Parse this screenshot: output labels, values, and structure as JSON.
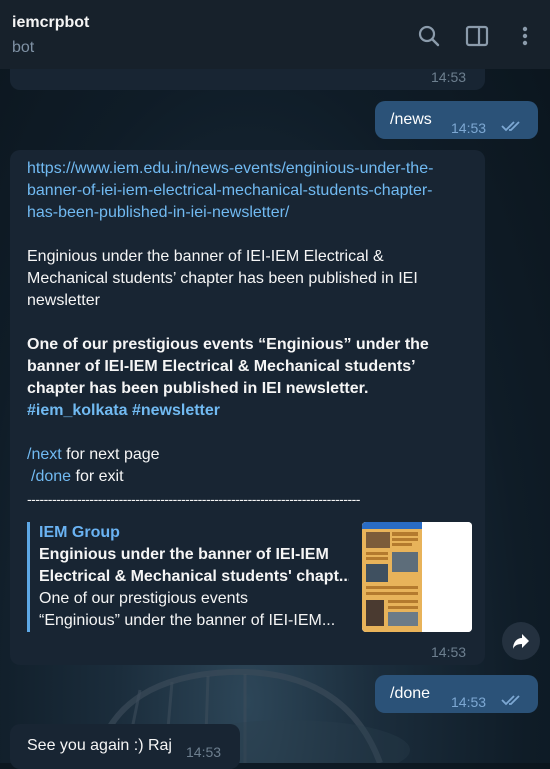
{
  "header": {
    "title": "iemcrpbot",
    "subtitle": "bot",
    "icons": [
      "search-icon",
      "sidebar-toggle-icon",
      "more-vertical-icon"
    ]
  },
  "messages": {
    "cutoff_time": "14:53",
    "news_cmd": {
      "text": "/news",
      "time": "14:53",
      "status": "read"
    },
    "article": {
      "url": "https://www.iem.edu.in/news-events/enginious-under-the-banner-of-iei-iem-electrical-mechanical-students-chapter-has-been-published-in-iei-newsletter/",
      "url_lines": [
        "https://www.iem.edu.in/news-events/enginious-under-the-",
        "banner-of-iei-iem-electrical-mechanical-students-chapter-",
        "has-been-published-in-iei-newsletter/"
      ],
      "title_lines": [
        "Enginious under the banner of IEI-IEM Electrical &",
        "Mechanical students’ chapter has been published in IEI",
        "newsletter"
      ],
      "bold_lines": [
        "One of our prestigious events “Enginious” under the",
        "banner of IEI-IEM Electrical & Mechanical students’",
        "chapter has been published in IEI newsletter."
      ],
      "hashtag_1": "#iem_kolkata",
      "hashtag_2": "#newsletter",
      "next_cmd": "/next",
      "next_text": " for next page",
      "done_cmd": "/done",
      "done_text": " for exit",
      "divider": "--------------------------------------------------------------------------------",
      "preview": {
        "site": "IEM Group",
        "title_1": "Enginious under the banner of IEI-IEM",
        "title_2": "Electrical & Mechanical students' chapt...",
        "desc_1": "One of our prestigious events",
        "desc_2": "“Enginious” under the banner of IEI-IEM..."
      },
      "time": "14:53"
    },
    "done_cmd": {
      "text": "/done",
      "time": "14:53",
      "status": "read"
    },
    "reply": {
      "text": "See you again :) Raj",
      "time": "14:53"
    }
  },
  "colors": {
    "header_bg": "#17212b",
    "incoming_bubble": "#182533",
    "outgoing_bubble": "#2b5278",
    "link": "#71baf2"
  }
}
